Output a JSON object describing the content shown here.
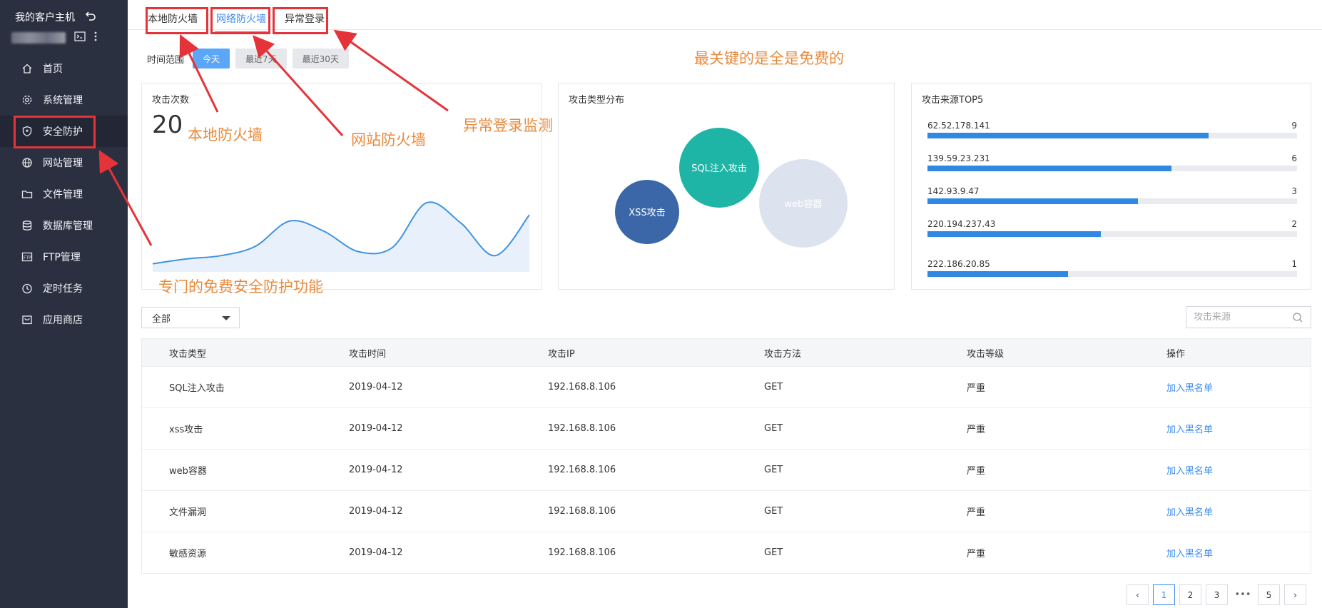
{
  "sidebar": {
    "title": "我的客户主机",
    "items": [
      {
        "label": "首页",
        "icon": "home-icon"
      },
      {
        "label": "系统管理",
        "icon": "gear-icon"
      },
      {
        "label": "安全防护",
        "icon": "shield-icon"
      },
      {
        "label": "网站管理",
        "icon": "globe-icon"
      },
      {
        "label": "文件管理",
        "icon": "folder-icon"
      },
      {
        "label": "数据库管理",
        "icon": "database-icon"
      },
      {
        "label": "FTP管理",
        "icon": "ftp-icon"
      },
      {
        "label": "定时任务",
        "icon": "clock-icon"
      },
      {
        "label": "应用商店",
        "icon": "store-icon"
      }
    ]
  },
  "tabs": [
    {
      "label": "本地防火墙"
    },
    {
      "label": "网络防火墙"
    },
    {
      "label": "异常登录"
    }
  ],
  "time_range": {
    "label": "时间范围",
    "options": [
      "今天",
      "最近7天",
      "最近30天"
    ]
  },
  "cards": {
    "attacks": {
      "title": "攻击次数",
      "count": "20"
    },
    "types": {
      "title": "攻击类型分布",
      "bubbles": [
        "SQL注入攻击",
        "XSS攻击",
        "web容器"
      ]
    },
    "sources": {
      "title": "攻击来源TOP5"
    }
  },
  "chart_data": [
    {
      "type": "area",
      "x": [
        0,
        1,
        2,
        3,
        4,
        5,
        6,
        7,
        8,
        9,
        10,
        11
      ],
      "values": [
        2,
        3.2,
        4,
        6.3,
        12.5,
        10,
        5,
        6,
        17,
        12,
        4,
        14
      ],
      "ylim": [
        0,
        20
      ]
    },
    {
      "type": "bar",
      "categories": [
        "62.52.178.141",
        "139.59.23.231",
        "142.93.9.47",
        "220.194.237.43",
        "222.186.20.85"
      ],
      "values": [
        9,
        6,
        3,
        2,
        1
      ],
      "fill_fraction": [
        0.76,
        0.66,
        0.57,
        0.47,
        0.38
      ]
    }
  ],
  "filter": {
    "select_value": "全部",
    "search_placeholder": "攻击来源"
  },
  "table": {
    "headers": [
      "攻击类型",
      "攻击时间",
      "攻击IP",
      "攻击方法",
      "攻击等级",
      "操作"
    ],
    "rows": [
      {
        "type": "SQL注入攻击",
        "time": "2019-04-12",
        "ip": "192.168.8.106",
        "method": "GET",
        "level": "严重",
        "action": "加入黑名单"
      },
      {
        "type": "xss攻击",
        "time": "2019-04-12",
        "ip": "192.168.8.106",
        "method": "GET",
        "level": "严重",
        "action": "加入黑名单"
      },
      {
        "type": "web容器",
        "time": "2019-04-12",
        "ip": "192.168.8.106",
        "method": "GET",
        "level": "严重",
        "action": "加入黑名单"
      },
      {
        "type": "文件漏洞",
        "time": "2019-04-12",
        "ip": "192.168.8.106",
        "method": "GET",
        "level": "严重",
        "action": "加入黑名单"
      },
      {
        "type": "敏感资源",
        "time": "2019-04-12",
        "ip": "192.168.8.106",
        "method": "GET",
        "level": "严重",
        "action": "加入黑名单"
      }
    ]
  },
  "pagination": {
    "pages": [
      "1",
      "2",
      "3",
      "5"
    ],
    "dots": "•••",
    "prev": "‹",
    "next": "›"
  },
  "annotations": {
    "local_fw": "本地防火墙",
    "web_fw": "网站防火墙",
    "login": "异常登录监测",
    "free": "最关键的是全是免费的",
    "security": "专门的免费安全防护功能"
  },
  "colors": {
    "accent": "#3b8cf0",
    "sidebar_bg": "#2b3040",
    "annotation": "#e88a3c",
    "box": "#e5333a"
  }
}
